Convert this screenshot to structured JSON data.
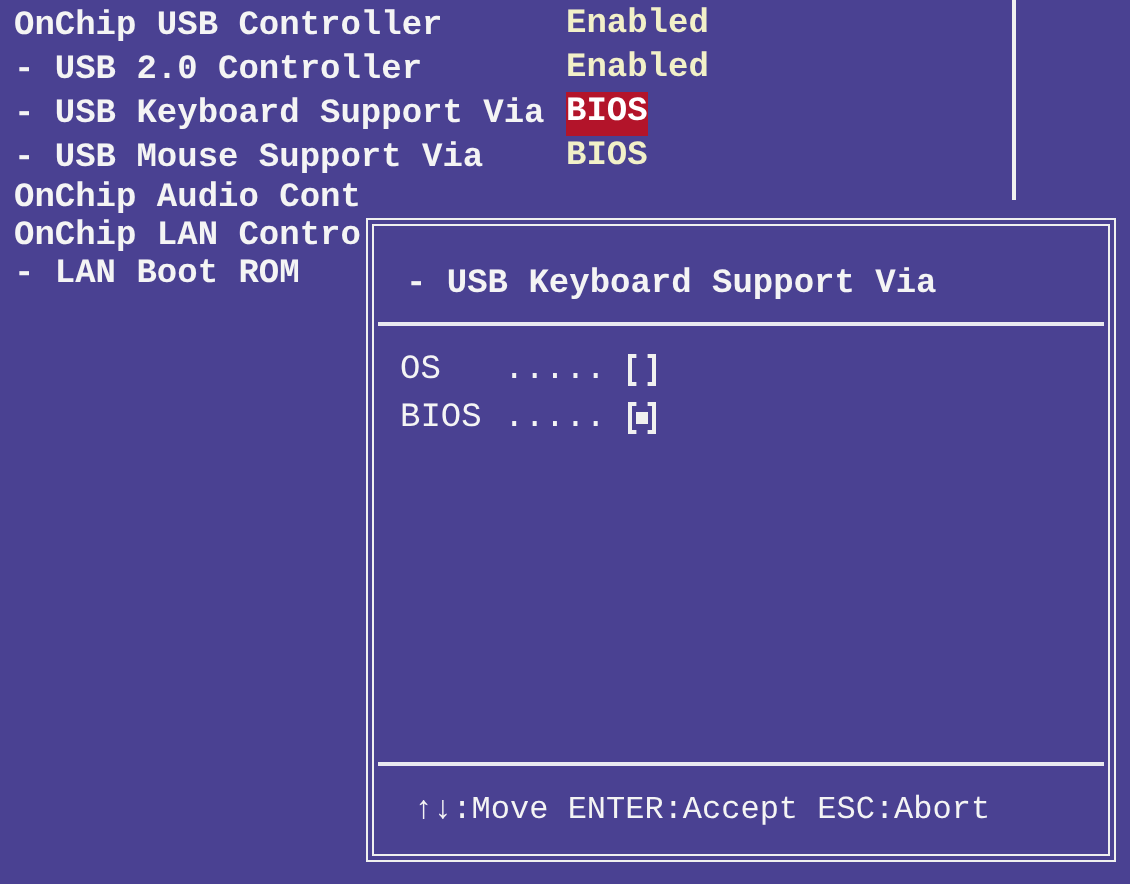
{
  "settings": [
    {
      "label": "OnChip USB Controller",
      "value": "Enabled",
      "selected": false
    },
    {
      "label": "- USB 2.0 Controller",
      "value": "Enabled",
      "selected": false
    },
    {
      "label": "- USB Keyboard Support Via",
      "value": "BIOS",
      "selected": true
    },
    {
      "label": "- USB Mouse Support Via",
      "value": "BIOS",
      "selected": false
    },
    {
      "label": "OnChip Audio Cont"
    },
    {
      "label": "OnChip LAN Contro"
    },
    {
      "label": "- LAN Boot ROM"
    }
  ],
  "popup": {
    "title": "- USB Keyboard Support Via",
    "options": [
      {
        "label": "OS",
        "dots": ".....",
        "selected": false
      },
      {
        "label": "BIOS",
        "dots": ".....",
        "selected": true
      }
    ],
    "footer": "↑↓:Move ENTER:Accept ESC:Abort"
  }
}
